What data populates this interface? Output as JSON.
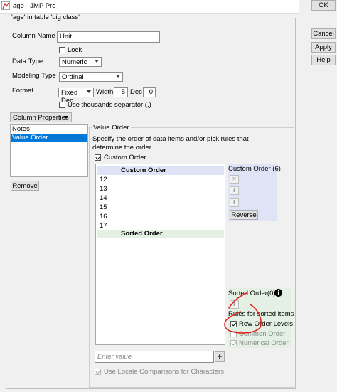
{
  "window": {
    "title": "age - JMP Pro"
  },
  "dialog": {
    "group_label": "'age' in table 'big class'",
    "column_name_label": "Column Name",
    "column_name_value": "Unit",
    "lock_label": "Lock",
    "lock_checked": false,
    "data_type_label": "Data Type",
    "data_type_value": "Numeric",
    "modeling_type_label": "Modeling Type",
    "modeling_type_value": "Ordinal",
    "format_label": "Format",
    "format_value": "Fixed Dec",
    "width_label": "Width",
    "width_value": "5",
    "dec_label": "Dec",
    "dec_value": "0",
    "thousands_label": "Use thousands separator (,)",
    "thousands_checked": false
  },
  "column_properties": {
    "menu_label": "Column Properties",
    "items": [
      "Notes",
      "Value Order"
    ],
    "selected": "Value Order",
    "remove_label": "Remove"
  },
  "value_order": {
    "group_label": "Value Order",
    "description_line1": "Specify the order of data items and/or pick rules that",
    "description_line2": "determine the order.",
    "custom_order_checkbox_label": "Custom Order",
    "custom_order_checked": true,
    "custom_header": "Custom Order",
    "custom_items": [
      "12",
      "13",
      "14",
      "15",
      "16",
      "17"
    ],
    "sorted_header": "Sorted Order",
    "custom_panel_title": "Custom Order (6)",
    "reverse_label": "Reverse",
    "sorted_panel_title": "Sorted Order(0)",
    "rules_label": "Rules for sorted items",
    "row_order_label": "Row Order Levels",
    "row_order_checked": true,
    "common_order_label": "Common Order",
    "common_order_checked": false,
    "numerical_order_label": "Numerical Order",
    "numerical_order_checked": true,
    "enter_value_placeholder": "Enter value",
    "add_label": "+",
    "locale_label": "Use Locale Comparisons for Characters",
    "locale_checked": true
  },
  "right_buttons": [
    "OK",
    "Cancel",
    "Apply",
    "Help"
  ],
  "colors": {
    "selection": "#0078d7",
    "custom_header_bg": "#dfe3f6",
    "sorted_header_bg": "#e3f0e3",
    "annotation": "#e1201e"
  }
}
